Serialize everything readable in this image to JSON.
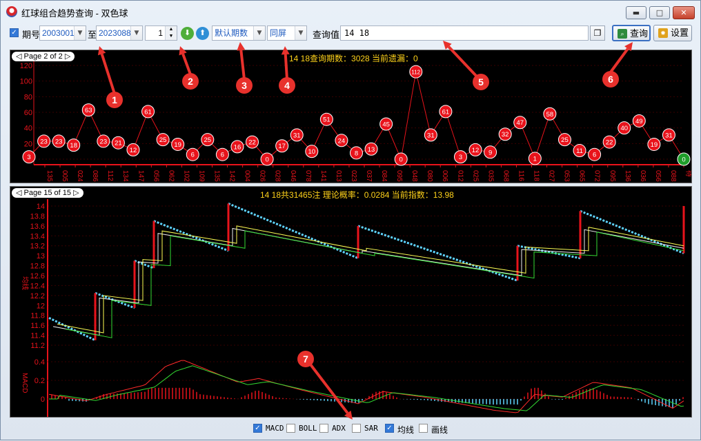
{
  "window": {
    "title": "红球组合趋势查询 - 双色球",
    "minimize_glyph": "▬",
    "maximize_glyph": "□",
    "close_glyph": "✕"
  },
  "toolbar": {
    "period_label": "期号",
    "period_from": "2003001",
    "to_label": "至",
    "period_to": "2023088",
    "step_value": "1",
    "down_icon": "down-arrow-icon",
    "up_icon": "up-arrow-icon",
    "mode_select": "默认期数",
    "screen_select": "同屏",
    "query_label": "查询值",
    "query_value": "14 18",
    "copy_icon": "copy-icon",
    "query_button": "查询",
    "settings_button": "设置",
    "checked": true
  },
  "top_panel": {
    "page_tag": "◁ Page 2 of 2 ▷",
    "caption": "14 18查询期数：3028 当前遗漏：0"
  },
  "bottom_panel": {
    "page_tag": "◁ Page 15 of 15 ▷",
    "caption": "14 18共31465注 理论概率：0.0284 当前指数：13.98"
  },
  "options": [
    {
      "label": "MACD",
      "checked": true
    },
    {
      "label": "BOLL",
      "checked": false
    },
    {
      "label": "ADX",
      "checked": false
    },
    {
      "label": "SAR",
      "checked": false
    },
    {
      "label": "均线",
      "checked": true
    },
    {
      "label": "画线",
      "checked": false
    }
  ],
  "callouts": [
    "1",
    "2",
    "3",
    "4",
    "5",
    "6",
    "7"
  ],
  "colors": {
    "accent": "#3479d8",
    "callout": "#e8312c",
    "ball": "#e8131b",
    "caption": "#ffd21a"
  },
  "chart_data": [
    {
      "type": "line",
      "title": "14 18查询期数：3028 当前遗漏：0",
      "ylim": [
        0,
        120
      ],
      "yticks": [
        0,
        20,
        40,
        60,
        80,
        100,
        120
      ],
      "x": [
        "135",
        "005",
        "024",
        "086",
        "112",
        "134",
        "147",
        "056",
        "062",
        "102",
        "109",
        "135",
        "142",
        "004",
        "026",
        "028",
        "046",
        "078",
        "141",
        "013",
        "023",
        "037",
        "084",
        "095",
        "048",
        "080",
        "006",
        "012",
        "025",
        "035",
        "068",
        "116",
        "118",
        "027",
        "053",
        "065",
        "072",
        "095",
        "136",
        "036",
        "056",
        "088",
        "待"
      ],
      "values": [
        3,
        23,
        23,
        18,
        63,
        23,
        21,
        12,
        61,
        25,
        19,
        6,
        25,
        6,
        16,
        22,
        0,
        17,
        31,
        10,
        51,
        24,
        8,
        13,
        45,
        0,
        112,
        31,
        61,
        3,
        12,
        9,
        32,
        47,
        1,
        58,
        25,
        11,
        6,
        22,
        40,
        49,
        19,
        31,
        0
      ]
    },
    {
      "type": "line",
      "title": "14 18共31465注 理论概率：0.0284 当前指数：13.98",
      "ylabel": "均线",
      "ylim": [
        11.2,
        14.0
      ],
      "yticks": [
        11.2,
        11.4,
        11.6,
        11.8,
        12,
        12.2,
        12.4,
        12.6,
        12.8,
        13,
        13.2,
        13.4,
        13.6,
        13.8,
        14
      ],
      "macd_label": "MACD",
      "macd_yticks": [
        0,
        0.2,
        0.4
      ]
    }
  ]
}
